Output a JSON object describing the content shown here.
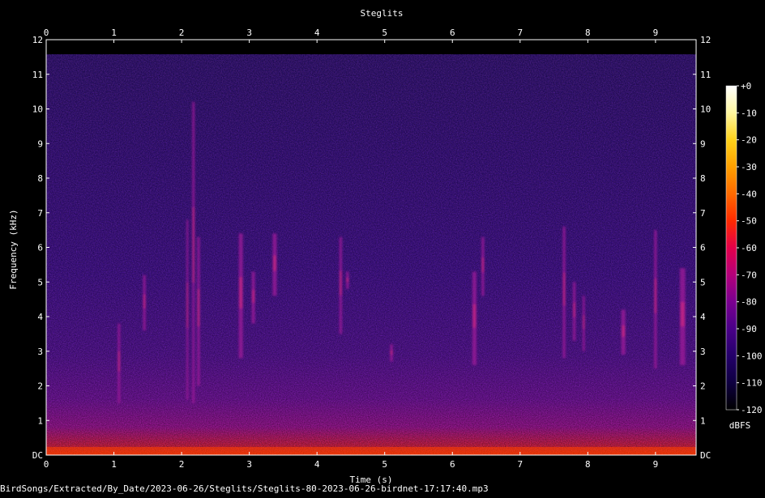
{
  "chart_data": {
    "type": "heatmap",
    "title": "Steglits",
    "xlabel": "Time (s)",
    "ylabel": "Frequency (kHz)",
    "xlim": [
      0,
      9.6
    ],
    "ylim": [
      0,
      12
    ],
    "x_ticks": [
      "0",
      "1",
      "2",
      "3",
      "4",
      "5",
      "6",
      "7",
      "8",
      "9"
    ],
    "y_ticks": [
      "DC",
      "1",
      "2",
      "3",
      "4",
      "5",
      "6",
      "7",
      "8",
      "9",
      "10",
      "11",
      "12"
    ],
    "colorbar": {
      "unit": "dBFS",
      "ticks": [
        "+0",
        "-10",
        "-20",
        "-30",
        "-40",
        "-50",
        "-60",
        "-70",
        "-80",
        "-90",
        "-100",
        "-110",
        "-120"
      ],
      "colors": [
        "#ffffff",
        "#fff7a0",
        "#ffd21a",
        "#ffa000",
        "#ff6a00",
        "#ff2a00",
        "#e4004a",
        "#b4007a",
        "#7a0090",
        "#4a0088",
        "#24006a",
        "#0e0040",
        "#000000"
      ]
    },
    "calls": [
      {
        "t0": 1.03,
        "t1": 1.12,
        "f0": 1.5,
        "f1": 3.8
      },
      {
        "t0": 1.4,
        "t1": 1.5,
        "f0": 3.6,
        "f1": 5.2
      },
      {
        "t0": 2.05,
        "t1": 2.12,
        "f0": 1.6,
        "f1": 6.8
      },
      {
        "t0": 2.13,
        "t1": 2.22,
        "f0": 1.5,
        "f1": 10.2
      },
      {
        "t0": 2.2,
        "t1": 2.3,
        "f0": 2.0,
        "f1": 6.3
      },
      {
        "t0": 2.8,
        "t1": 2.95,
        "f0": 2.8,
        "f1": 6.4
      },
      {
        "t0": 3.0,
        "t1": 3.12,
        "f0": 3.8,
        "f1": 5.3
      },
      {
        "t0": 3.3,
        "t1": 3.45,
        "f0": 4.6,
        "f1": 6.4
      },
      {
        "t0": 4.3,
        "t1": 4.4,
        "f0": 3.5,
        "f1": 6.3
      },
      {
        "t0": 4.4,
        "t1": 4.5,
        "f0": 4.8,
        "f1": 5.3
      },
      {
        "t0": 5.05,
        "t1": 5.15,
        "f0": 2.7,
        "f1": 3.2
      },
      {
        "t0": 6.25,
        "t1": 6.4,
        "f0": 2.6,
        "f1": 5.3
      },
      {
        "t0": 6.4,
        "t1": 6.5,
        "f0": 4.6,
        "f1": 6.3
      },
      {
        "t0": 7.6,
        "t1": 7.7,
        "f0": 2.8,
        "f1": 6.6
      },
      {
        "t0": 7.75,
        "t1": 7.85,
        "f0": 3.3,
        "f1": 5.0
      },
      {
        "t0": 7.9,
        "t1": 7.98,
        "f0": 3.0,
        "f1": 4.6
      },
      {
        "t0": 8.45,
        "t1": 8.6,
        "f0": 2.9,
        "f1": 4.2
      },
      {
        "t0": 8.95,
        "t1": 9.05,
        "f0": 2.5,
        "f1": 6.5
      },
      {
        "t0": 9.3,
        "t1": 9.5,
        "f0": 2.6,
        "f1": 5.4
      }
    ]
  },
  "footer_text": "BirdSongs/Extracted/By_Date/2023-06-26/Steglits/Steglits-80-2023-06-26-birdnet-17:17:40.mp3"
}
